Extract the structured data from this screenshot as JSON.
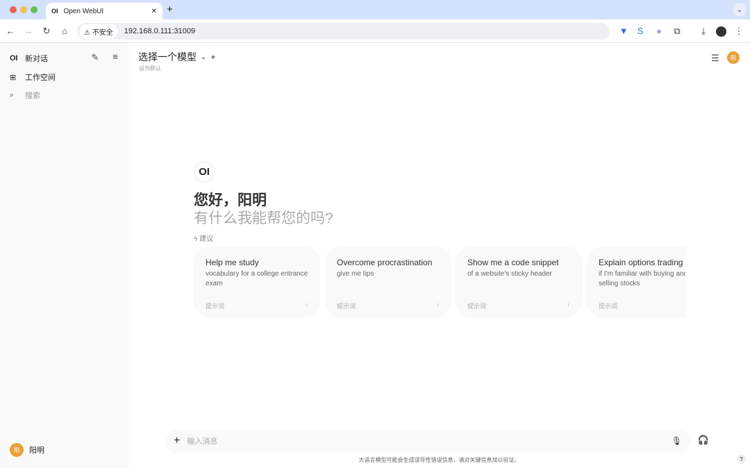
{
  "browser": {
    "tab_title": "Open WebUI",
    "tab_icon": "OI",
    "security_label": "不安全",
    "url": "192.168.0.111:31009"
  },
  "sidebar": {
    "logo": "OI",
    "new_chat": "新对话",
    "workspace": "工作空间",
    "search_placeholder": "搜索",
    "user_name": "阳明",
    "user_initial": "阳"
  },
  "header": {
    "model_select": "选择一个模型",
    "set_default": "设为默认",
    "user_initial": "阳"
  },
  "welcome": {
    "logo": "OI",
    "greeting": "您好，阳明",
    "subtitle": "有什么我能帮您的吗?",
    "suggestions_label": "建议"
  },
  "suggestions": [
    {
      "title": "Help me study",
      "desc": "vocabulary for a college entrance exam",
      "tag": "提示词"
    },
    {
      "title": "Overcome procrastination",
      "desc": "give me tips",
      "tag": "提示词"
    },
    {
      "title": "Show me a code snippet",
      "desc": "of a website's sticky header",
      "tag": "提示词"
    },
    {
      "title": "Explain options trading",
      "desc": "if I'm familiar with buying and selling stocks",
      "tag": "提示词"
    }
  ],
  "input": {
    "placeholder": "输入消息"
  },
  "footer": {
    "disclaimer": "大语言模型可能会生成误导性错误信息，请对关键信息加以验证。",
    "help": "?"
  },
  "colors": {
    "accent": "#e8a13a",
    "tabbar": "#d3e3fd",
    "sidebar": "#f9f9f9"
  }
}
